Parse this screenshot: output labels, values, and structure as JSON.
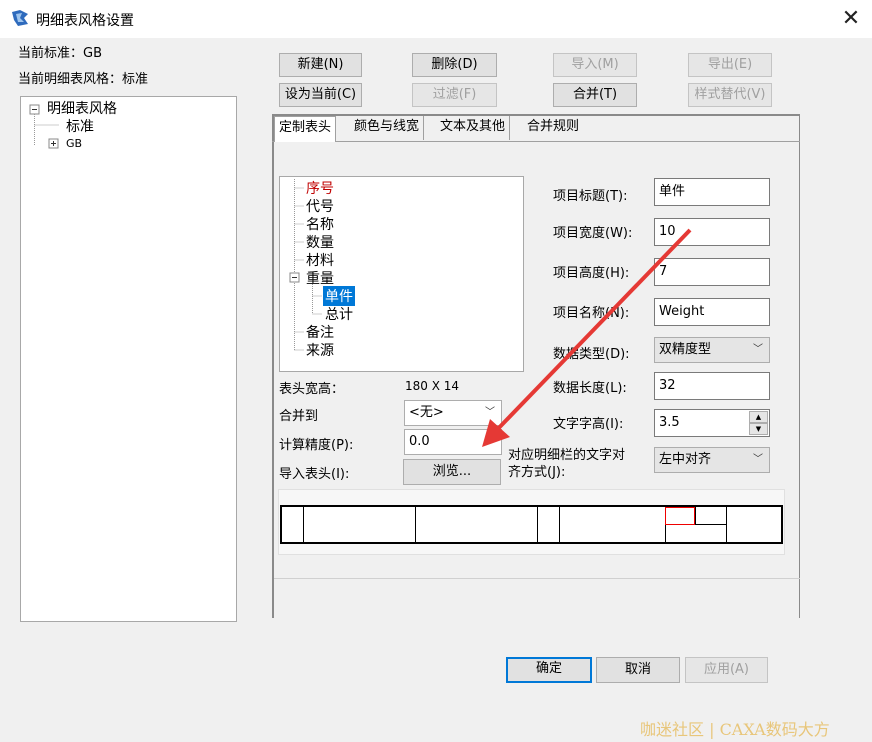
{
  "window": {
    "title": "明细表风格设置",
    "close": "✕"
  },
  "info": {
    "current_standard": "当前标准：GB",
    "current_style": "当前明细表风格：标准"
  },
  "left_tree": {
    "root": "明细表风格",
    "child1": "标准",
    "child2": "GB"
  },
  "buttons": {
    "new": "新建(N)",
    "delete": "删除(D)",
    "import": "导入(M)",
    "export": "导出(E)",
    "set_current": "设为当前(C)",
    "filter": "过滤(F)",
    "merge": "合并(T)",
    "style_replace": "样式替代(V)",
    "ok": "确定",
    "cancel": "取消",
    "apply": "应用(A)"
  },
  "tabs": [
    "定制表头",
    "颜色与线宽",
    "文本及其他",
    "合并规则"
  ],
  "header_tree": {
    "items": [
      "序号",
      "代号",
      "名称",
      "数量",
      "材料",
      "重量",
      "单件",
      "总计",
      "备注",
      "来源"
    ]
  },
  "left_form": {
    "header_size_label": "表头宽高：",
    "header_size_value": "180 X 14",
    "merge_to_label": "合并到",
    "merge_to_value": "<无>",
    "precision_label": "计算精度(P):",
    "precision_value": "0.0",
    "import_header_label": "导入表头(I):",
    "browse": "浏览..."
  },
  "right_form": {
    "item_title_label": "项目标题(T):",
    "item_title_value": "单件",
    "item_width_label": "项目宽度(W):",
    "item_width_value": "10",
    "item_height_label": "项目高度(H):",
    "item_height_value": "7",
    "item_name_label": "项目名称(N):",
    "item_name_value": "Weight",
    "data_type_label": "数据类型(D):",
    "data_type_value": "双精度型",
    "data_length_label": "数据长度(L):",
    "data_length_value": "32",
    "text_height_label": "文字字高(I):",
    "text_height_value": "3.5",
    "align_label_1": "对应明细栏的文字对",
    "align_label_2": "齐方式(J):",
    "align_value": "左中对齐"
  },
  "watermark": "咖迷社区 | CAXA数码大方",
  "colors": {
    "selected_bg": "#0078d7",
    "first_item": "#c00000",
    "arrow": "#e53935"
  }
}
